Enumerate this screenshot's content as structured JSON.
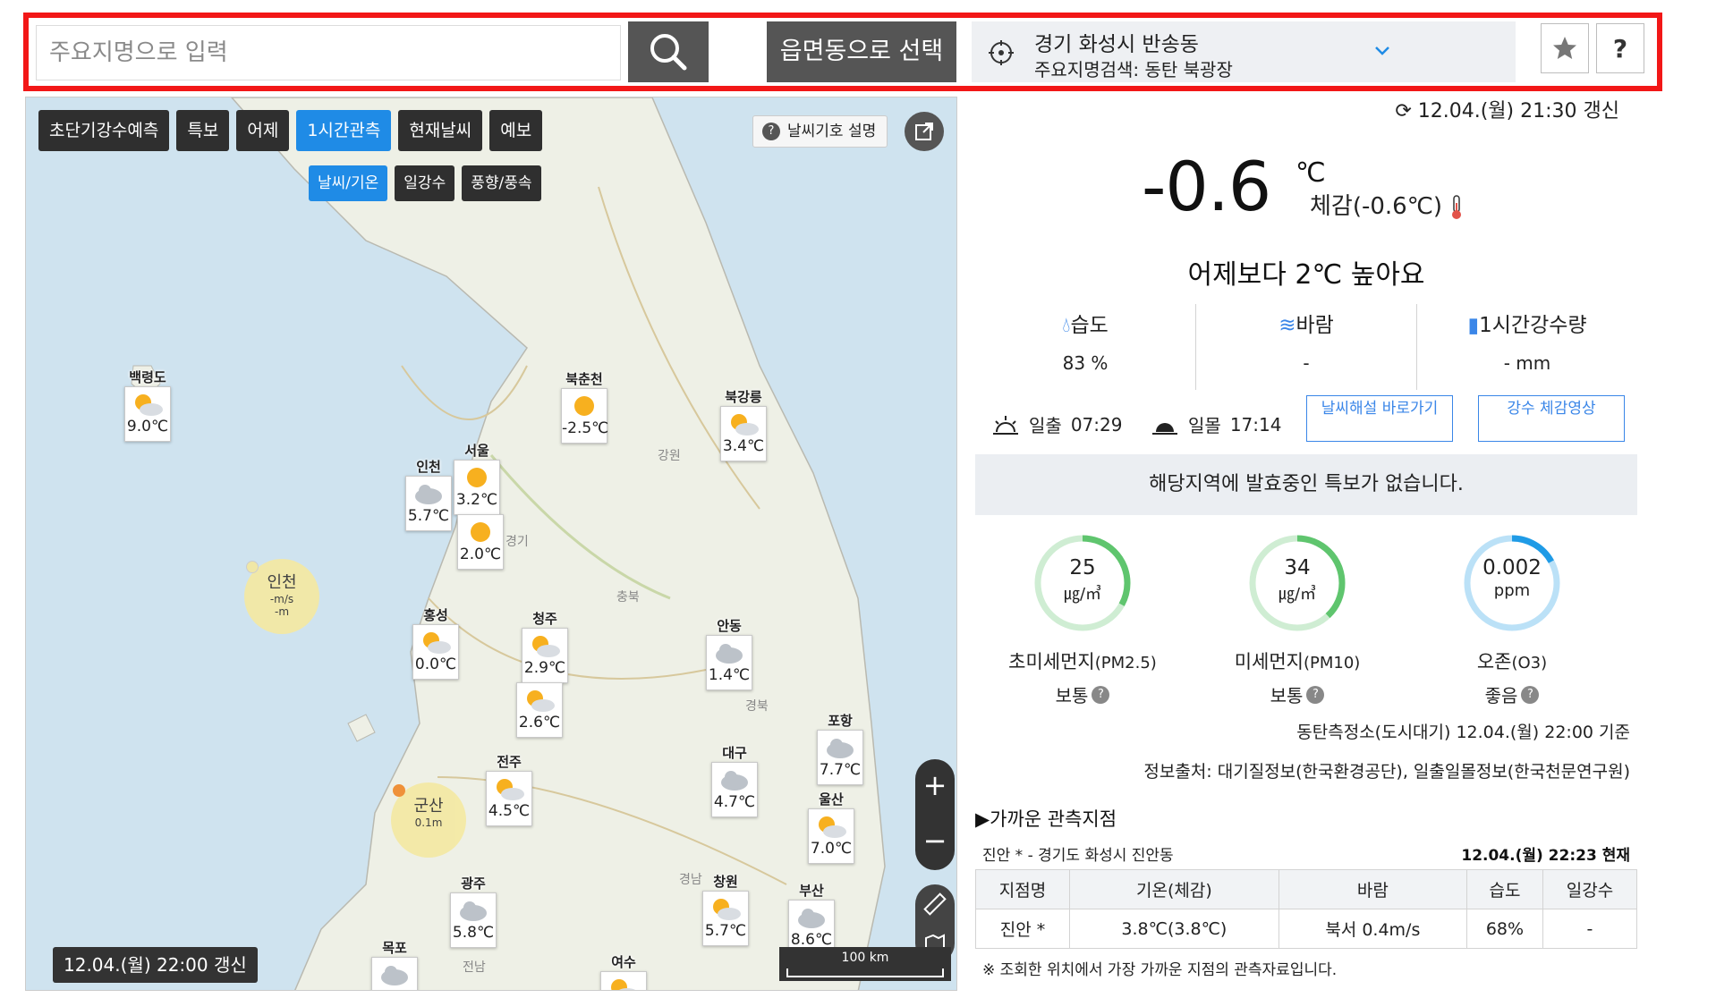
{
  "search": {
    "placeholder": "주요지명으로 입력",
    "select_button": "읍면동으로 선택",
    "location_name": "경기 화성시 반송동",
    "location_sub": "주요지명검색: 동탄 북광장",
    "help_label": "?"
  },
  "map": {
    "tabs": [
      "초단기강수예측",
      "특보",
      "어제",
      "1시간관측",
      "현재날씨",
      "예보"
    ],
    "active_tab": "1시간관측",
    "subtabs": [
      "날씨/기온",
      "일강수",
      "풍향/풍속"
    ],
    "active_subtab": "날씨/기온",
    "legend_button": "날씨기호 설명",
    "update_time": "12.04.(월) 22:00 갱신",
    "scale_label": "100 km",
    "region_labels": [
      "강원",
      "경기",
      "충북",
      "경북",
      "전남",
      "경남"
    ],
    "stations": [
      {
        "name": "백령도",
        "temp": "9.0℃",
        "icon": "partly-sunny-icon"
      },
      {
        "name": "북춘천",
        "temp": "-2.5℃",
        "icon": "sun-icon"
      },
      {
        "name": "북강릉",
        "temp": "3.4℃",
        "icon": "partly-sunny-icon"
      },
      {
        "name": "인천",
        "temp": "5.7℃",
        "icon": "cloud-icon"
      },
      {
        "name": "서울",
        "temp": "3.2℃",
        "icon": "sun-icon"
      },
      {
        "name": "",
        "temp": "2.0℃",
        "icon": "sun-icon"
      },
      {
        "name": "홍성",
        "temp": "0.0℃",
        "icon": "partly-sunny-icon"
      },
      {
        "name": "청주",
        "temp": "2.9℃",
        "icon": "partly-sunny-icon"
      },
      {
        "name": "",
        "temp": "2.6℃",
        "icon": "partly-sunny-icon"
      },
      {
        "name": "안동",
        "temp": "1.4℃",
        "icon": "cloud-icon"
      },
      {
        "name": "포항",
        "temp": "7.7℃",
        "icon": "cloud-icon"
      },
      {
        "name": "대구",
        "temp": "4.7℃",
        "icon": "cloud-icon"
      },
      {
        "name": "울산",
        "temp": "7.0℃",
        "icon": "partly-sunny-icon"
      },
      {
        "name": "전주",
        "temp": "4.5℃",
        "icon": "partly-sunny-icon"
      },
      {
        "name": "광주",
        "temp": "5.8℃",
        "icon": "cloud-icon"
      },
      {
        "name": "창원",
        "temp": "5.7℃",
        "icon": "partly-sunny-icon"
      },
      {
        "name": "부산",
        "temp": "8.6℃",
        "icon": "cloud-icon"
      },
      {
        "name": "목포",
        "temp": "",
        "icon": "cloud-icon"
      },
      {
        "name": "여수",
        "temp": "",
        "icon": "partly-sunny-icon"
      }
    ],
    "marine": [
      {
        "name": "인천",
        "l1": "-m/s",
        "l2": "-m"
      },
      {
        "name": "군산",
        "l1": "0.1m",
        "l2": ""
      }
    ]
  },
  "current": {
    "updated": "12.04.(월) 21:30 갱신",
    "temp": "-0.6",
    "unit": "℃",
    "feels": "체감(-0.6℃)",
    "compare": "어제보다 2℃ 높아요",
    "humidity_label": "습도",
    "humidity_value": "83 %",
    "wind_label": "바람",
    "wind_value": "-",
    "rain_label": "1시간강수량",
    "rain_value": "- mm",
    "sunrise_label": "일출",
    "sunrise_time": "07:29",
    "sunset_label": "일몰",
    "sunset_time": "17:14",
    "btn_commentary": "날씨해설 바로가기",
    "btn_rainvideo": "강수 체감영상",
    "notice": "해당지역에 발효중인 특보가 없습니다."
  },
  "air": [
    {
      "value": "25",
      "unit": "㎍/㎥",
      "name": "초미세먼지",
      "code": "(PM2.5)",
      "state": "보통",
      "fraction": 0.33,
      "color": "#5fc56e"
    },
    {
      "value": "34",
      "unit": "㎍/㎥",
      "name": "미세먼지",
      "code": "(PM10)",
      "state": "보통",
      "fraction": 0.38,
      "color": "#5fc56e"
    },
    {
      "value": "0.002",
      "unit": "ppm",
      "name": "오존",
      "code": "(O3)",
      "state": "좋음",
      "fraction": 0.17,
      "color": "#1f9be6"
    }
  ],
  "sources": {
    "station": "동탄측정소(도시대기) 12.04.(월) 22:00 기준",
    "info": "정보출처: 대기질정보(한국환경공단), 일출일몰정보(한국천문연구원)"
  },
  "nearby": {
    "title": "▶가까운 관측지점",
    "location": "진안 * - 경기도 화성시 진안동",
    "time": "12.04.(월) 22:23 현재",
    "headers": [
      "지점명",
      "기온(체감)",
      "바람",
      "습도",
      "일강수"
    ],
    "row": [
      "진안 *",
      "3.8℃(3.8℃)",
      "북서 0.4m/s",
      "68%",
      "-"
    ],
    "footnote": "※ 조회한 위치에서 가장 가까운 지점의 관측자료입니다."
  },
  "colors": {
    "accent": "#1f8be6",
    "highlight_border": "#f21717",
    "dark_button": "#555555"
  }
}
